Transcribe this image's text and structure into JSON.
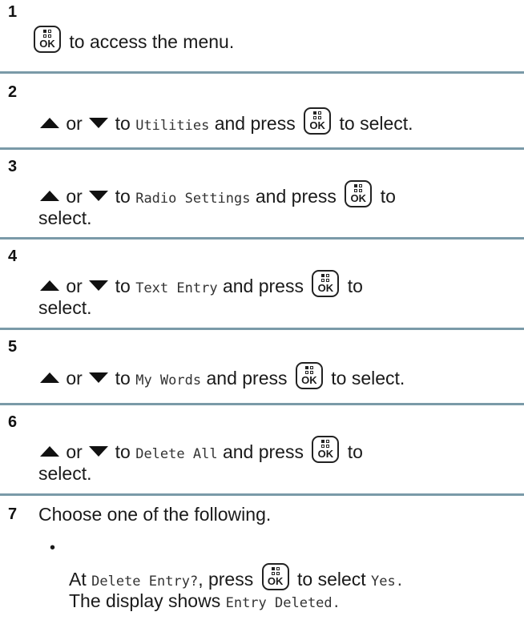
{
  "steps": [
    {
      "num": "1",
      "before": "",
      "after": "to access the menu."
    },
    {
      "num": "2",
      "or": "or",
      "to": "to",
      "item": "Utilities",
      "press": "and press",
      "tail": "to select."
    },
    {
      "num": "3",
      "or": "or",
      "to": "to",
      "item": "Radio Settings",
      "press": "and press",
      "tail": "to",
      "tail2": "select."
    },
    {
      "num": "4",
      "or": "or",
      "to": "to",
      "item": "Text Entry",
      "press": "and press",
      "tail": "to",
      "tail2": "select."
    },
    {
      "num": "5",
      "or": "or",
      "to": "to",
      "item": "My Words",
      "press": "and press",
      "tail": "to select."
    },
    {
      "num": "6",
      "or": "or",
      "to": "to",
      "item": "Delete All",
      "press": "and press",
      "tail": "to",
      "tail2": "select."
    },
    {
      "num": "7",
      "text": "Choose one of the following."
    }
  ],
  "bullet": {
    "symbol": "•",
    "at": "At",
    "prompt": "Delete Entry?",
    "press": ", press",
    "to_select": "to select",
    "yes": "Yes.",
    "display_shows": "The display shows",
    "result": "Entry Deleted."
  },
  "key": {
    "label": "OK"
  }
}
